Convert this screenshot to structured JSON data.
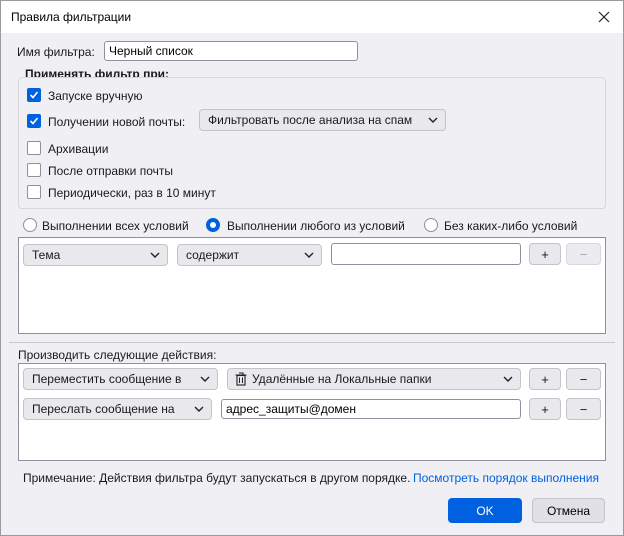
{
  "window": {
    "title": "Правила фильтрации"
  },
  "filter_name": {
    "label": "Имя фильтра:",
    "value": "Черный список"
  },
  "apply": {
    "heading": "Применять фильтр при:",
    "manual": {
      "label": "Запуске вручную",
      "checked": true
    },
    "new_mail": {
      "label": "Получении новой почты:",
      "checked": true,
      "dropdown": "Фильтровать после анализа на спам"
    },
    "archive": {
      "label": "Архивации",
      "checked": false
    },
    "after_send": {
      "label": "После отправки почты",
      "checked": false
    },
    "periodic": {
      "label": "Периодически, раз в 10 минут",
      "checked": false
    }
  },
  "match": {
    "all": "Выполнении всех условий",
    "any": "Выполнении любого из условий",
    "none": "Без каких-либо условий",
    "selected": "any"
  },
  "condition": {
    "field": "Тема",
    "operator": "содержит",
    "value": "",
    "add": "+",
    "remove": "−"
  },
  "actions": {
    "heading": "Производить следующие действия:",
    "rows": [
      {
        "action": "Переместить сообщение в",
        "target": "Удалённые на Локальные папки",
        "add": "+",
        "remove": "−"
      },
      {
        "action": "Переслать сообщение на",
        "target": "адрес_защиты@домен",
        "add": "+",
        "remove": "−"
      }
    ]
  },
  "note": {
    "text": "Примечание: Действия фильтра будут запускаться в другом порядке.",
    "link": "Посмотреть порядок выполнения"
  },
  "buttons": {
    "ok": "OK",
    "cancel": "Отмена"
  },
  "colors": {
    "accent": "#0061e0",
    "background": "#f0f0f4"
  }
}
